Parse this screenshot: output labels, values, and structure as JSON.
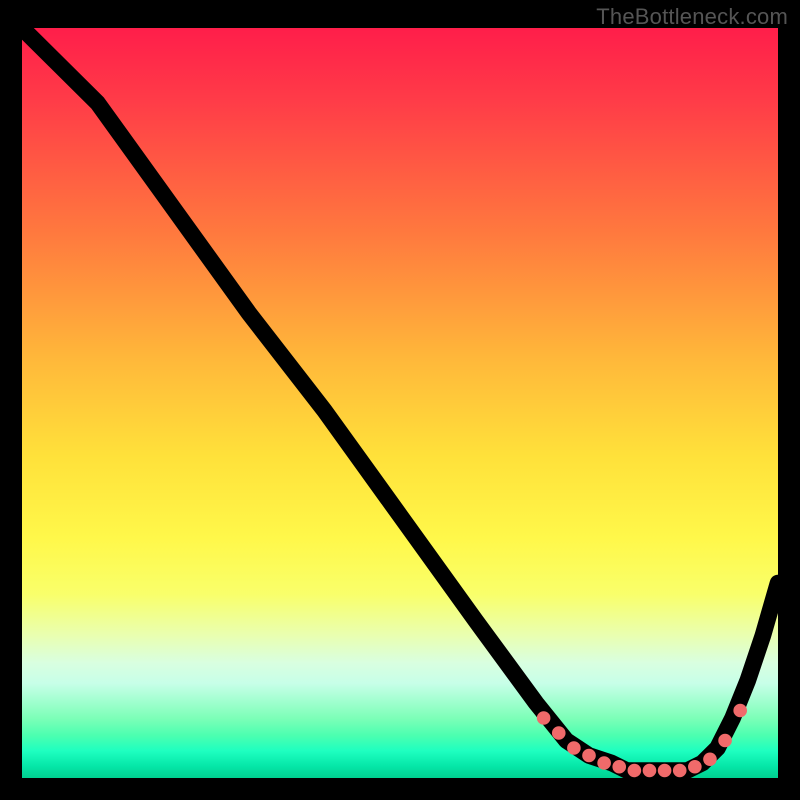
{
  "attribution": "TheBottleneck.com",
  "colors": {
    "background": "#000000",
    "curve": "#000000",
    "marker": "#f06a6a",
    "gradient_top": "#ff1e4a",
    "gradient_mid": "#ffe13a",
    "gradient_bottom": "#00d090"
  },
  "chart_data": {
    "type": "line",
    "title": "",
    "xlabel": "",
    "ylabel": "",
    "xlim": [
      0,
      100
    ],
    "ylim": [
      0,
      100
    ],
    "x": [
      0,
      8,
      10,
      20,
      30,
      40,
      50,
      60,
      68,
      72,
      75,
      78,
      80,
      82,
      84,
      86,
      88,
      90,
      92,
      94,
      96,
      98,
      100
    ],
    "y": [
      100,
      92,
      90,
      76,
      62,
      49,
      35,
      21,
      10,
      5,
      3,
      2,
      1,
      1,
      1,
      1,
      1,
      2,
      4,
      8,
      13,
      19,
      26
    ],
    "markers": {
      "x": [
        69,
        71,
        73,
        75,
        77,
        79,
        81,
        83,
        85,
        87,
        89,
        91,
        93,
        95
      ],
      "y": [
        8,
        6,
        4,
        3,
        2,
        1.5,
        1,
        1,
        1,
        1,
        1.5,
        2.5,
        5,
        9
      ]
    }
  }
}
